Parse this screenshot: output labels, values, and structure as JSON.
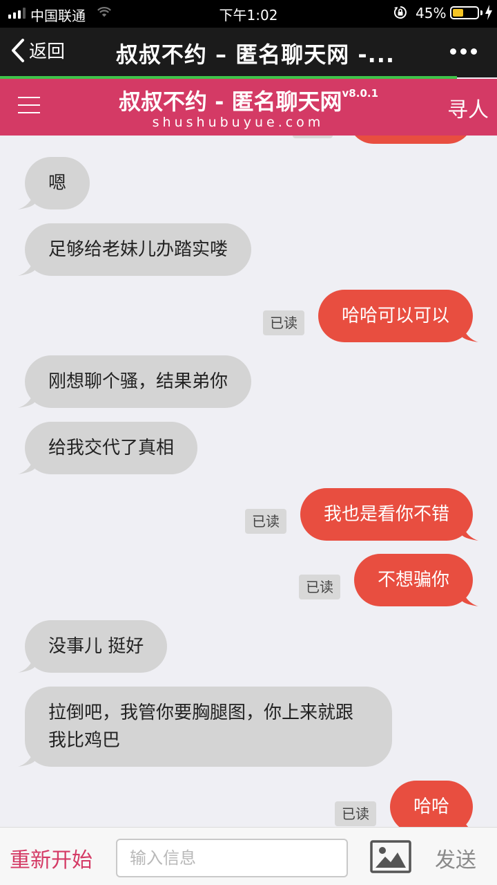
{
  "status_bar": {
    "carrier": "中国联通",
    "time": "下午1:02",
    "battery_pct": "45%",
    "battery_level": 0.45,
    "signal_bars_active": 3,
    "signal_bars_total": 4,
    "battery_fill_color": "#f6c524"
  },
  "nav": {
    "back_label": "返回",
    "title": "叔叔不约 – 匿名聊天网 -...",
    "more_icon": "more-dots-icon",
    "load_progress": 0.92
  },
  "app_header": {
    "title": "叔叔不约 - 匿名聊天网",
    "version": "v8.0.1",
    "domain": "shushubuyue.com",
    "right_label": "寻人",
    "menu_icon": "hamburger-icon",
    "bg_color": "#d43a65"
  },
  "chat": {
    "read_label": "已读",
    "messages": [
      {
        "dir": "in",
        "text": "嗯"
      },
      {
        "dir": "in",
        "text": "足够给老妹儿办踏实喽"
      },
      {
        "dir": "out",
        "text": "哈哈可以可以",
        "status": "已读"
      },
      {
        "dir": "in",
        "text": "刚想聊个骚，结果弟你"
      },
      {
        "dir": "in",
        "text": "给我交代了真相"
      },
      {
        "dir": "out",
        "text": "我也是看你不错",
        "status": "已读"
      },
      {
        "dir": "out",
        "text": "不想骗你",
        "status": "已读"
      },
      {
        "dir": "in",
        "text": "没事儿 挺好"
      },
      {
        "dir": "in",
        "lines": [
          "拉倒吧，我管你要胸腿图，你上来就跟",
          "我比鸡巴"
        ]
      },
      {
        "dir": "out",
        "text": "哈哈",
        "status": "已读"
      }
    ],
    "incoming_color": "#d4d4d4",
    "outgoing_color": "#e84e40"
  },
  "bottom_bar": {
    "restart_label": "重新开始",
    "input_placeholder": "输入信息",
    "input_value": "",
    "image_icon": "image-icon",
    "send_label": "发送"
  }
}
